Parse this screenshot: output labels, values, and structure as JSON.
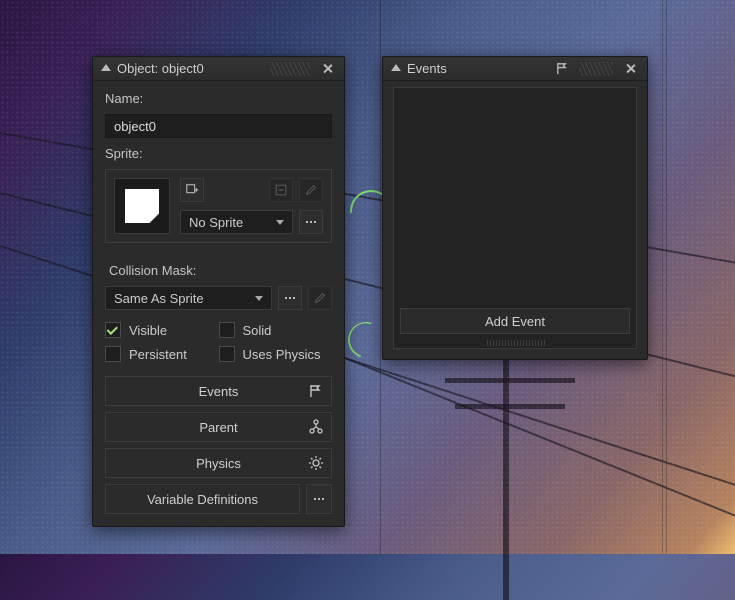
{
  "object_panel": {
    "title": "Object: object0",
    "name_label": "Name:",
    "name_value": "object0",
    "sprite_label": "Sprite:",
    "sprite_selected": "No Sprite",
    "collision_mask_label": "Collision Mask:",
    "collision_mask_value": "Same As Sprite",
    "checks": {
      "visible": {
        "label": "Visible",
        "checked": true
      },
      "solid": {
        "label": "Solid",
        "checked": false
      },
      "persistent": {
        "label": "Persistent",
        "checked": false
      },
      "uses_physics": {
        "label": "Uses Physics",
        "checked": false
      }
    },
    "nav": {
      "events": "Events",
      "parent": "Parent",
      "physics": "Physics",
      "vardefs": "Variable Definitions"
    }
  },
  "events_panel": {
    "title": "Events",
    "add_event": "Add Event"
  }
}
